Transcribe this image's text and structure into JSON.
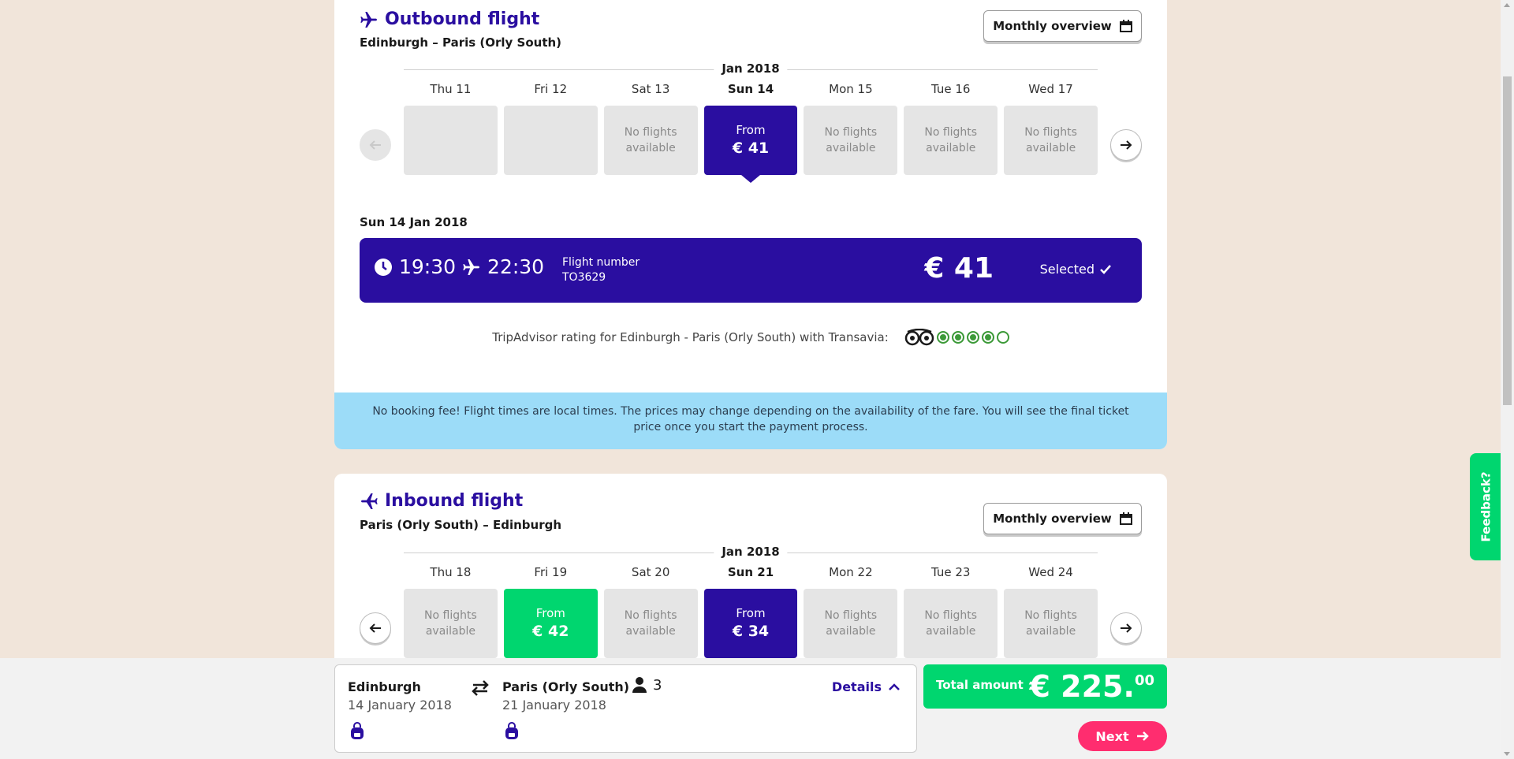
{
  "outbound": {
    "title": "Outbound flight",
    "route": "Edinburgh – Paris (Orly South)",
    "monthly_label": "Monthly overview",
    "month": "Jan 2018",
    "days": [
      {
        "name": "Thu 11",
        "status": "empty",
        "line1": "",
        "line2": ""
      },
      {
        "name": "Fri 12",
        "status": "empty",
        "line1": "",
        "line2": ""
      },
      {
        "name": "Sat 13",
        "status": "none",
        "line1": "No flights",
        "line2": "available"
      },
      {
        "name": "Sun 14",
        "status": "selected",
        "line1": "From",
        "line2": "€ 41"
      },
      {
        "name": "Mon 15",
        "status": "none",
        "line1": "No flights",
        "line2": "available"
      },
      {
        "name": "Tue 16",
        "status": "none",
        "line1": "No flights",
        "line2": "available"
      },
      {
        "name": "Wed 17",
        "status": "none",
        "line1": "No flights",
        "line2": "available"
      }
    ],
    "selected_date": "Sun 14 Jan 2018",
    "flight": {
      "depart": "19:30",
      "arrive": "22:30",
      "number_label": "Flight number",
      "number": "TO3629",
      "price": "€ 41",
      "selected_label": "Selected"
    },
    "tripadvisor_text": "TripAdvisor rating for Edinburgh - Paris (Orly South) with Transavia:",
    "rating": 4,
    "rating_max": 5,
    "notice": "No booking fee! Flight times are local times. The prices may change depending on the availability of the fare. You will see the final ticket price once you start the payment process."
  },
  "inbound": {
    "title": "Inbound flight",
    "route": "Paris (Orly South) – Edinburgh",
    "monthly_label": "Monthly overview",
    "month": "Jan 2018",
    "days": [
      {
        "name": "Thu 18",
        "status": "none",
        "line1": "No flights",
        "line2": "available"
      },
      {
        "name": "Fri 19",
        "status": "green",
        "line1": "From",
        "line2": "€ 42"
      },
      {
        "name": "Sat 20",
        "status": "none",
        "line1": "No flights",
        "line2": "available"
      },
      {
        "name": "Sun 21",
        "status": "selected",
        "line1": "From",
        "line2": "€ 34"
      },
      {
        "name": "Mon 22",
        "status": "none",
        "line1": "No flights",
        "line2": "available"
      },
      {
        "name": "Tue 23",
        "status": "none",
        "line1": "No flights",
        "line2": "available"
      },
      {
        "name": "Wed 24",
        "status": "none",
        "line1": "No flights",
        "line2": "available"
      }
    ]
  },
  "summary": {
    "from_city": "Edinburgh",
    "from_date": "14 January 2018",
    "to_city": "Paris (Orly South)",
    "to_date": "21 January 2018",
    "passengers": "3",
    "details_label": "Details",
    "total_label": "Total amount",
    "total_main": "€ 225.",
    "total_cents": "00",
    "next_label": "Next"
  },
  "feedback_label": "Feedback?",
  "colors": {
    "brand": "#2a0ea0",
    "green": "#00d66f",
    "pink": "#ff2d6f",
    "notice": "#9cdcf8"
  }
}
